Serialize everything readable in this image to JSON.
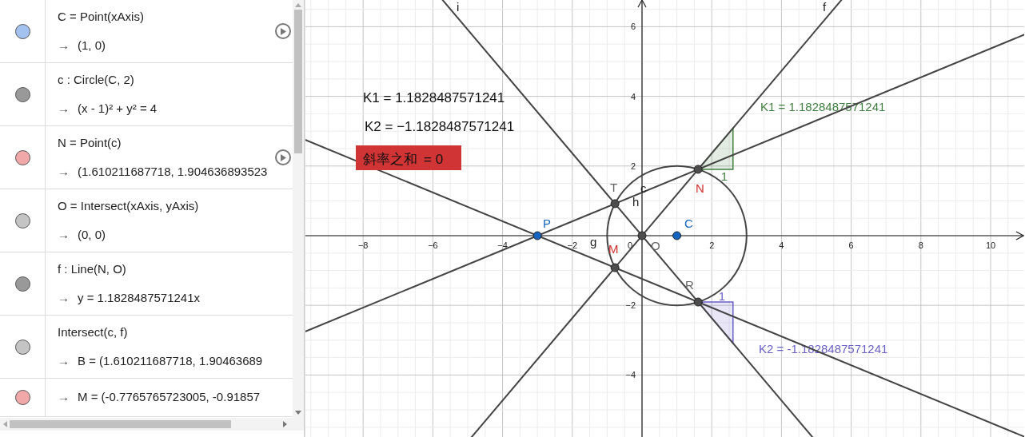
{
  "algebra_view": {
    "rows": [
      {
        "color": "#a4c2f0",
        "definition": "C = Point(xAxis)",
        "arrow": "→",
        "value": "(1, 0)",
        "play_button": true
      },
      {
        "color": "#999999",
        "definition": "c : Circle(C, 2)",
        "arrow": "→",
        "value": "(x - 1)² + y² = 4",
        "play_button": false
      },
      {
        "color": "#f0a8a8",
        "definition": "N = Point(c)",
        "arrow": "→",
        "value": "(1.610211687718, 1.904636893523",
        "play_button": true
      },
      {
        "color": "#c4c4c4",
        "definition": "O = Intersect(xAxis, yAxis)",
        "arrow": "→",
        "value": "(0, 0)",
        "play_button": false
      },
      {
        "color": "#999999",
        "definition": "f : Line(N, O)",
        "arrow": "→",
        "value": "y = 1.1828487571241x",
        "play_button": false
      },
      {
        "color": "#c4c4c4",
        "definition": "Intersect(c, f)",
        "arrow": "→",
        "value": "B = (1.610211687718, 1.90463689",
        "play_button": false
      },
      {
        "color": "#f0a8a8",
        "arrow": "→",
        "value": "M = (-0.7765765723005, -0.91857",
        "play_button": false
      }
    ]
  },
  "graphics": {
    "x_labels": [
      "−8",
      "−6",
      "−4",
      "−2",
      "0",
      "2",
      "4",
      "6",
      "8",
      "10"
    ],
    "y_labels": [
      "6",
      "4",
      "2",
      "−2",
      "−4"
    ],
    "equations": [
      "K1 = 1.1828487571241",
      "K2 = −1.1828487571241"
    ],
    "slope_sum": {
      "label": "斜率之和",
      "value": "= 0"
    },
    "lines": [
      {
        "label": "i"
      },
      {
        "label": "f"
      },
      {
        "label": "h"
      },
      {
        "label": "g"
      }
    ],
    "circle": {
      "label": "c"
    },
    "slope_triangles": [
      {
        "label": "1",
        "text": "K1 = 1.1828487571241",
        "color": "#3f7f3f"
      },
      {
        "label": "1",
        "text": "K2 = -1.1828487571241",
        "color": "#6a5fc8"
      }
    ],
    "points": [
      {
        "color": "#1565c0",
        "label": {
          "text": "P",
          "color": "#1565c0"
        }
      },
      {
        "color": "#1565c0",
        "label": {
          "text": "C",
          "color": "#1565c0"
        }
      },
      {
        "color": "#4d4d4d",
        "label": {
          "text": "N",
          "color": "#d32f2f"
        }
      },
      {
        "color": "#4d4d4d",
        "label": {
          "text": "O",
          "color": "#666666"
        }
      },
      {
        "color": "#4d4d4d",
        "label": {
          "text": "T",
          "color": "#666666"
        }
      },
      {
        "color": "#4d4d4d",
        "label": {
          "text": "M",
          "color": "#d32f2f"
        }
      },
      {
        "color": "#4d4d4d",
        "label": {
          "text": "R",
          "color": "#666666"
        }
      }
    ]
  }
}
